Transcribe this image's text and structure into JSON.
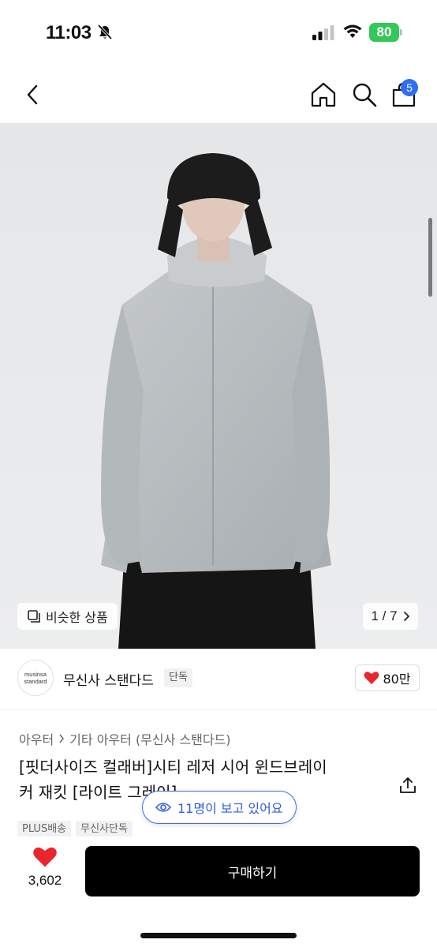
{
  "status_bar": {
    "time": "11:03",
    "battery": "80",
    "icons": [
      "bell-slash-icon",
      "signal-icon",
      "wifi-icon",
      "battery-icon"
    ]
  },
  "nav": {
    "icons": [
      "chevron-left-icon",
      "home-icon",
      "search-icon",
      "bag-icon"
    ],
    "cart_count": "5"
  },
  "image": {
    "similar_label": "비슷한 상품",
    "pager": "1 / 7"
  },
  "brand": {
    "logo_line1": "musinsa",
    "logo_line2": "standard",
    "name": "무신사 스탠다드",
    "badge": "단독",
    "likes": "80만"
  },
  "product": {
    "category_1": "아우터",
    "category_2": "기타 아우터 (무신사 스탠다드)",
    "title_line1": "[핏더사이즈 컬래버]시티 레저 시어 윈드브레이",
    "title_line2": "커 재킷 [라이트 그레이]",
    "tags": [
      "PLUS배송",
      "무신사단독"
    ],
    "viewers": "11명이 보고 있어요"
  },
  "bottom_bar": {
    "wish_count": "3,602",
    "buy_label": "구매하기"
  },
  "colors": {
    "accent_blue": "#2f6ef6",
    "like_red": "#e8262b",
    "battery_green": "#34c759",
    "buy_black": "#000000"
  }
}
